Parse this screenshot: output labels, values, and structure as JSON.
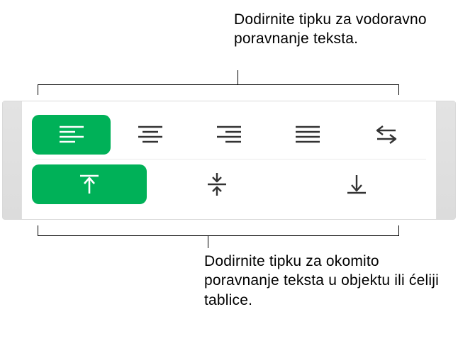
{
  "callouts": {
    "top": "Dodirnite tipku za vodoravno poravnanje teksta.",
    "bottom": "Dodirnite tipku za okomito poravnanje teksta u objektu ili ćeliji tablice."
  },
  "alignment": {
    "horizontal": {
      "selected": "left",
      "buttons": [
        {
          "id": "left",
          "icon": "align-left"
        },
        {
          "id": "center",
          "icon": "align-center"
        },
        {
          "id": "right",
          "icon": "align-right"
        },
        {
          "id": "justify",
          "icon": "align-justify"
        },
        {
          "id": "bidi",
          "icon": "text-direction"
        }
      ]
    },
    "vertical": {
      "selected": "top",
      "buttons": [
        {
          "id": "top",
          "icon": "valign-top"
        },
        {
          "id": "middle",
          "icon": "valign-middle"
        },
        {
          "id": "bottom",
          "icon": "valign-bottom"
        }
      ]
    }
  },
  "colors": {
    "accent": "#00b158"
  }
}
